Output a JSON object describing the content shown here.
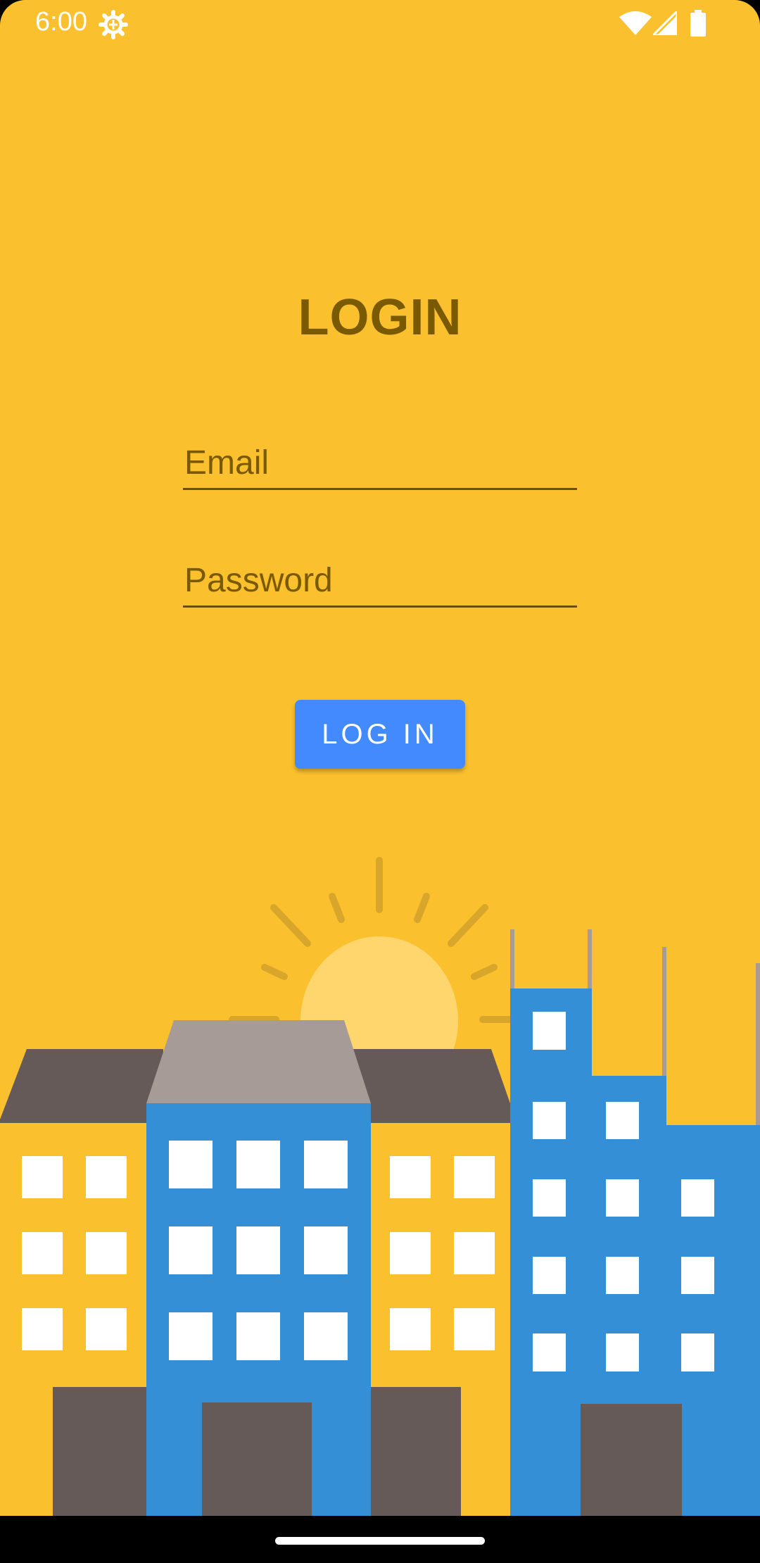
{
  "status_bar": {
    "time": "6:00",
    "icons": [
      "settings-gear-icon",
      "wifi-icon",
      "cell-signal-icon",
      "battery-icon"
    ]
  },
  "login": {
    "title": "LOGIN",
    "email_placeholder": "Email",
    "email_value": "",
    "password_placeholder": "Password",
    "password_value": "",
    "button_label": "LOG IN"
  },
  "colors": {
    "background": "#FBC02D",
    "accent_button": "#448AFF",
    "text_dark": "#7A5A00",
    "building_blue": "#348FD6",
    "roof_dark": "#655A58",
    "roof_grey": "#A69B97",
    "sun": "#FFD66E",
    "window": "#FFFFFF"
  },
  "illustration": {
    "type": "city-skyline-with-sun"
  }
}
